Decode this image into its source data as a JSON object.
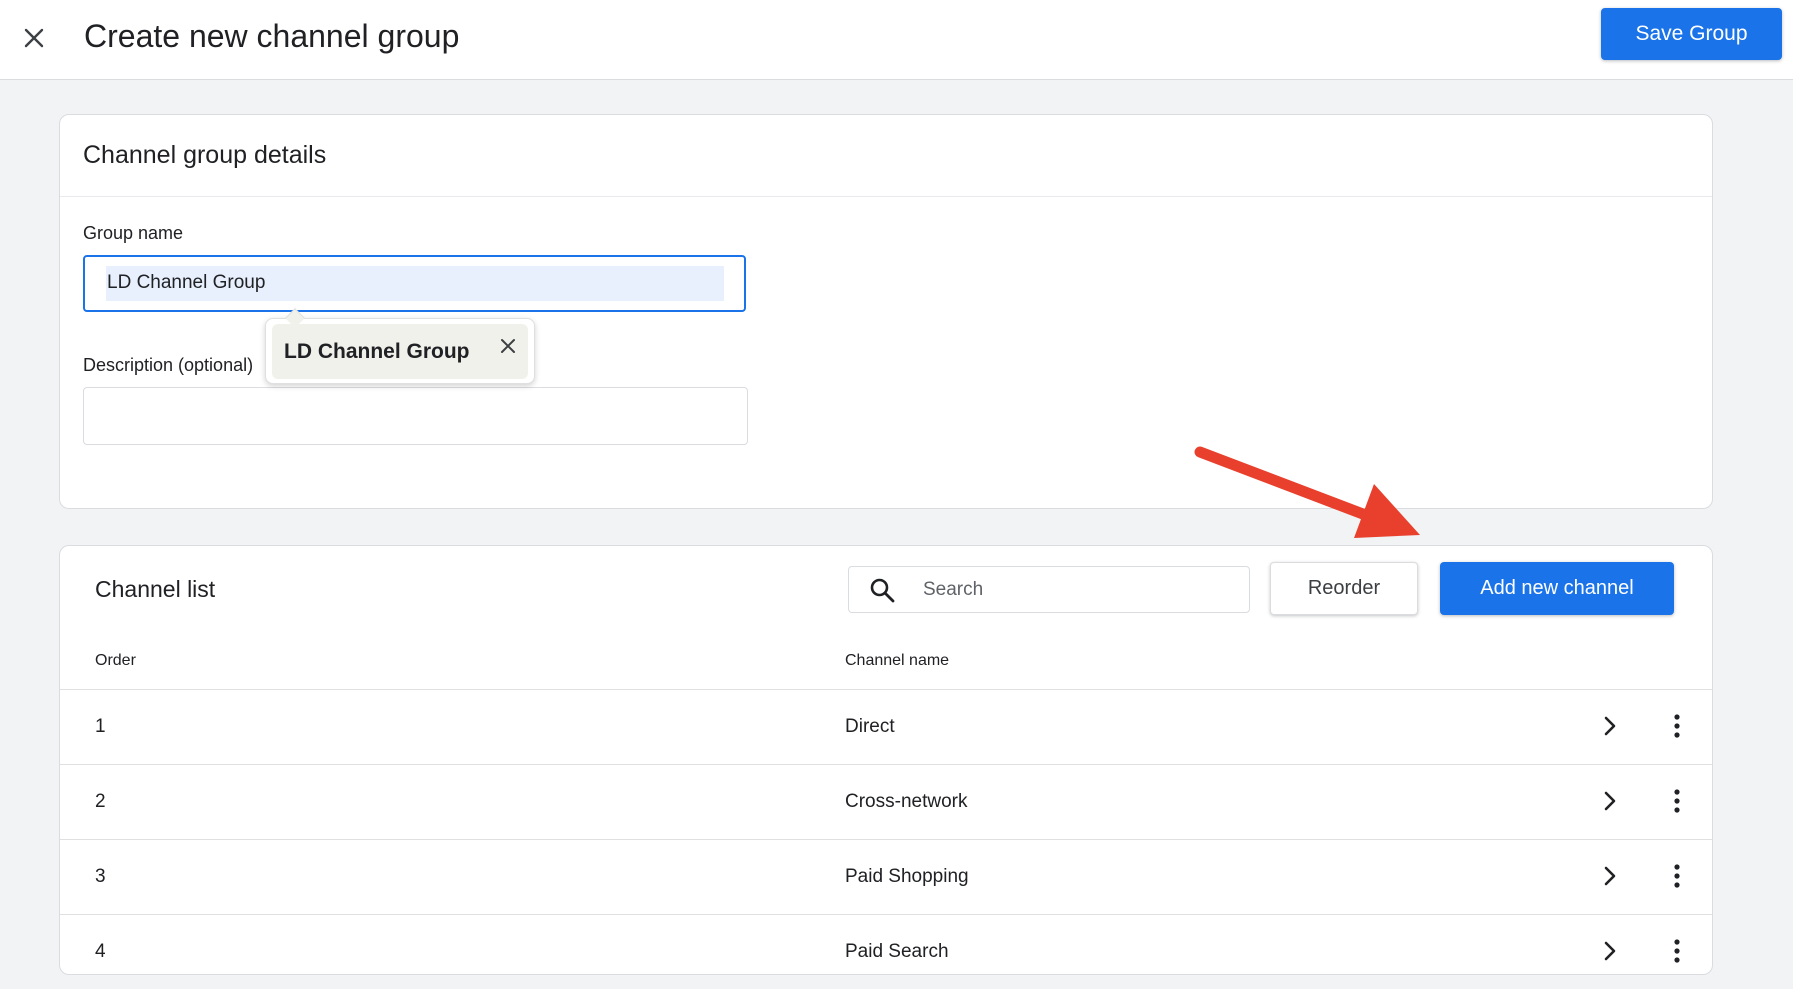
{
  "header": {
    "title": "Create new channel group",
    "close_icon": "close-icon",
    "save_label": "Save Group",
    "accent_color": "#1a73e8"
  },
  "details": {
    "title": "Channel group details",
    "group_name_label": "Group name",
    "group_name_value": "LD Channel Group",
    "description_label": "Description (optional)",
    "description_value": "",
    "autofill_suggestion": "LD Channel Group"
  },
  "channel_list": {
    "title": "Channel list",
    "search_placeholder": "Search",
    "reorder_label": "Reorder",
    "add_label": "Add new channel",
    "columns": {
      "order": "Order",
      "name": "Channel name"
    },
    "rows": [
      {
        "order": "1",
        "name": "Direct"
      },
      {
        "order": "2",
        "name": "Cross-network"
      },
      {
        "order": "3",
        "name": "Paid Shopping"
      },
      {
        "order": "4",
        "name": "Paid Search"
      }
    ]
  },
  "annotation": {
    "type": "red-arrow",
    "target": "Add new channel",
    "color": "#e8402c"
  }
}
